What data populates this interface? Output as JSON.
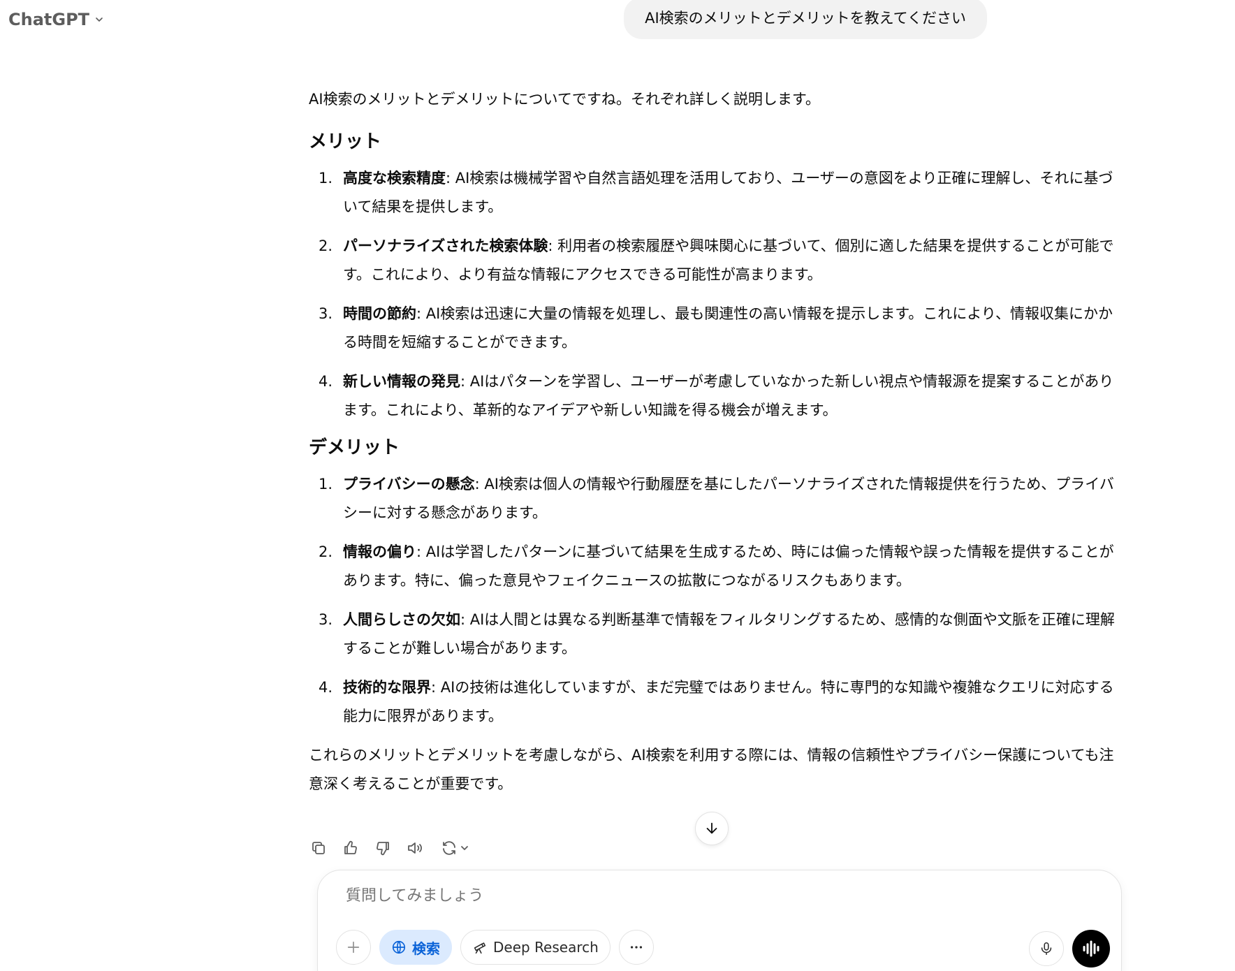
{
  "header": {
    "model_label": "ChatGPT",
    "model_icon": "chevron-down-icon"
  },
  "user_message": "AI検索のメリットとデメリットを教えてください",
  "answer": {
    "intro": "AI検索のメリットとデメリットについてですね。それぞれ詳しく説明します。",
    "merits_heading": "メリット",
    "merits": [
      {
        "num": "1.",
        "title": "高度な検索精度",
        "text": ": AI検索は機械学習や自然言語処理を活用しており、ユーザーの意図をより正確に理解し、それに基づいて結果を提供します。"
      },
      {
        "num": "2.",
        "title": "パーソナライズされた検索体験",
        "text": ": 利用者の検索履歴や興味関心に基づいて、個別に適した結果を提供することが可能です。これにより、より有益な情報にアクセスできる可能性が高まります。"
      },
      {
        "num": "3.",
        "title": "時間の節約",
        "text": ": AI検索は迅速に大量の情報を処理し、最も関連性の高い情報を提示します。これにより、情報収集にかかる時間を短縮することができます。"
      },
      {
        "num": "4.",
        "title": "新しい情報の発見",
        "text": ": AIはパターンを学習し、ユーザーが考慮していなかった新しい視点や情報源を提案することがあります。これにより、革新的なアイデアや新しい知識を得る機会が増えます。"
      }
    ],
    "demerits_heading": "デメリット",
    "demerits": [
      {
        "num": "1.",
        "title": "プライバシーの懸念",
        "text": ": AI検索は個人の情報や行動履歴を基にしたパーソナライズされた情報提供を行うため、プライバシーに対する懸念があります。"
      },
      {
        "num": "2.",
        "title": "情報の偏り",
        "text": ": AIは学習したパターンに基づいて結果を生成するため、時には偏った情報や誤った情報を提供することがあります。特に、偏った意見やフェイクニュースの拡散につながるリスクもあります。"
      },
      {
        "num": "3.",
        "title": "人間らしさの欠如",
        "text": ": AIは人間とは異なる判断基準で情報をフィルタリングするため、感情的な側面や文脈を正確に理解することが難しい場合があります。"
      },
      {
        "num": "4.",
        "title": "技術的な限界",
        "text": ": AIの技術は進化していますが、まだ完璧ではありません。特に専門的な知識や複雑なクエリに対応する能力に限界があります。"
      }
    ],
    "outro": "これらのメリットとデメリットを考慮しながら、AI検索を利用する際には、情報の信頼性やプライバシー保護についても注意深く考えることが重要です。"
  },
  "actions": [
    "copy-icon",
    "thumbs-up-icon",
    "thumbs-down-icon",
    "read-aloud-icon",
    "regenerate-icon"
  ],
  "composer": {
    "placeholder": "質問してみましょう",
    "search_label": "検索",
    "deep_research_label": "Deep Research",
    "accent_color": "#0b63d8"
  }
}
